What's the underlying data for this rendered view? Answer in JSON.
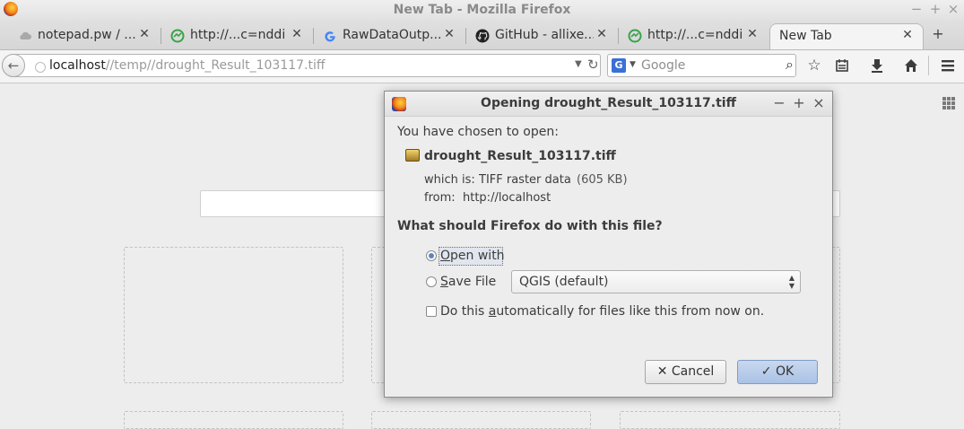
{
  "window": {
    "title": "New Tab - Mozilla Firefox",
    "buttons": [
      "−",
      "+",
      "×"
    ]
  },
  "tabs": [
    {
      "label": "notepad.pw / ...",
      "icon": "cloud-icon"
    },
    {
      "label": "http://...c=nddi",
      "icon": "green-globe-icon"
    },
    {
      "label": "RawDataOutp...",
      "icon": "google-icon"
    },
    {
      "label": "GitHub - allixe...",
      "icon": "github-icon"
    },
    {
      "label": "http://...c=nddi",
      "icon": "green-globe-icon"
    },
    {
      "label": "New Tab",
      "icon": "",
      "active": true
    }
  ],
  "newtab_symbol": "+",
  "toolbar": {
    "url_host": "localhost",
    "url_path": "//temp//drought_Result_103117.tiff",
    "search_engine_letter": "G",
    "search_placeholder": "Google",
    "icons": [
      "star-icon",
      "reading-list-icon",
      "download-icon",
      "home-icon",
      "menu-icon"
    ]
  },
  "dialog": {
    "title": "Opening drought_Result_103117.tiff",
    "intro": "You have chosen to open:",
    "file_name": "drought_Result_103117.tiff",
    "which_is_label": "which is:",
    "which_is_value": "TIFF raster data",
    "file_size": "(605 KB)",
    "from_label": "from:",
    "from_value": "http://localhost",
    "question": "What should Firefox do with this file?",
    "open_with_label": "Open with",
    "open_with_selected": true,
    "application": "QGIS (default)",
    "save_file_label": "Save File",
    "save_file_selected": false,
    "auto_label": "Do this automatically for files like this from now on.",
    "auto_checked": false,
    "cancel_label": "Cancel",
    "ok_label": "OK"
  }
}
